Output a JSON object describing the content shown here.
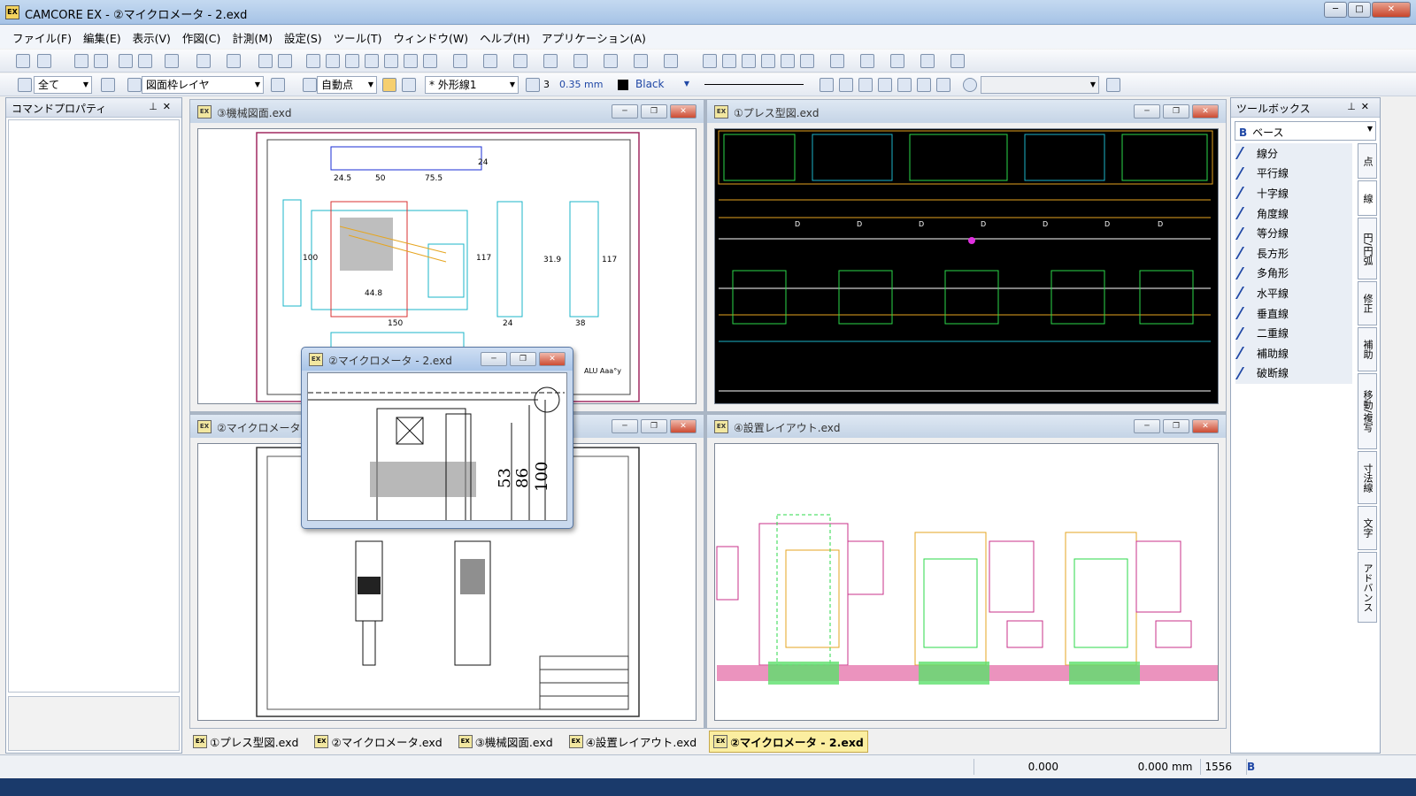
{
  "app": {
    "title": "CAMCORE EX - ②マイクロメータ - 2.exd",
    "icon_label": "EX"
  },
  "window_controls": {
    "minimize": "─",
    "maximize": "□",
    "close": "✕"
  },
  "menu": [
    "ファイル(F)",
    "編集(E)",
    "表示(V)",
    "作図(C)",
    "計測(M)",
    "設定(S)",
    "ツール(T)",
    "ウィンドウ(W)",
    "ヘルプ(H)",
    "アプリケーション(A)"
  ],
  "toolbar2": {
    "select_filter": "全て",
    "layer": "図面枠レイヤ",
    "snap_mode": "自動点",
    "line_type": "* 外形線1",
    "line_width_index": "3",
    "line_width_value": "0.35 mm",
    "color_name": "Black"
  },
  "command_panel": {
    "title": "コマンドプロパティ"
  },
  "toolbox": {
    "title": "ツールボックス",
    "category": "ベース",
    "category_badge": "B",
    "items": [
      "線分",
      "平行線",
      "十字線",
      "角度線",
      "等分線",
      "長方形",
      "多角形",
      "水平線",
      "垂直線",
      "二重線",
      "補助線",
      "破断線"
    ],
    "side_tabs": [
      "点",
      "線",
      "円/円弧",
      "修正",
      "補助",
      "移動/複写",
      "寸法線",
      "文字",
      "アドバンス"
    ]
  },
  "docs": {
    "kikai": "③機械図面.exd",
    "press": "①プレス型図.exd",
    "micro2": "②マイクロメータ - 2.exd",
    "micro_behind": "②マイクロメータ",
    "layout": "④設置レイアウト.exd"
  },
  "drawing_text": {
    "kikai_dims": [
      "24.5",
      "50",
      "75.5",
      "24",
      "100",
      "117",
      "44.8",
      "150",
      "24",
      "38",
      "31.9",
      "117"
    ],
    "kikai_note": "ALU Aaa°y",
    "press_labels": [
      "D",
      "D",
      "D",
      "D",
      "D",
      "D",
      "D"
    ],
    "micro_dims": [
      "53",
      "86",
      "100"
    ]
  },
  "doc_tabs": [
    "①プレス型図.exd",
    "②マイクロメータ.exd",
    "③機械図面.exd",
    "④設置レイアウト.exd",
    "②マイクロメータ - 2.exd"
  ],
  "status": {
    "x": "0.000",
    "y": "0.000",
    "unit": "mm",
    "scale": "1556",
    "badge": "B"
  },
  "colors": {
    "accent": "#1f47a5",
    "cad_bg": "#000000",
    "active_tab": "#fbeea0"
  }
}
